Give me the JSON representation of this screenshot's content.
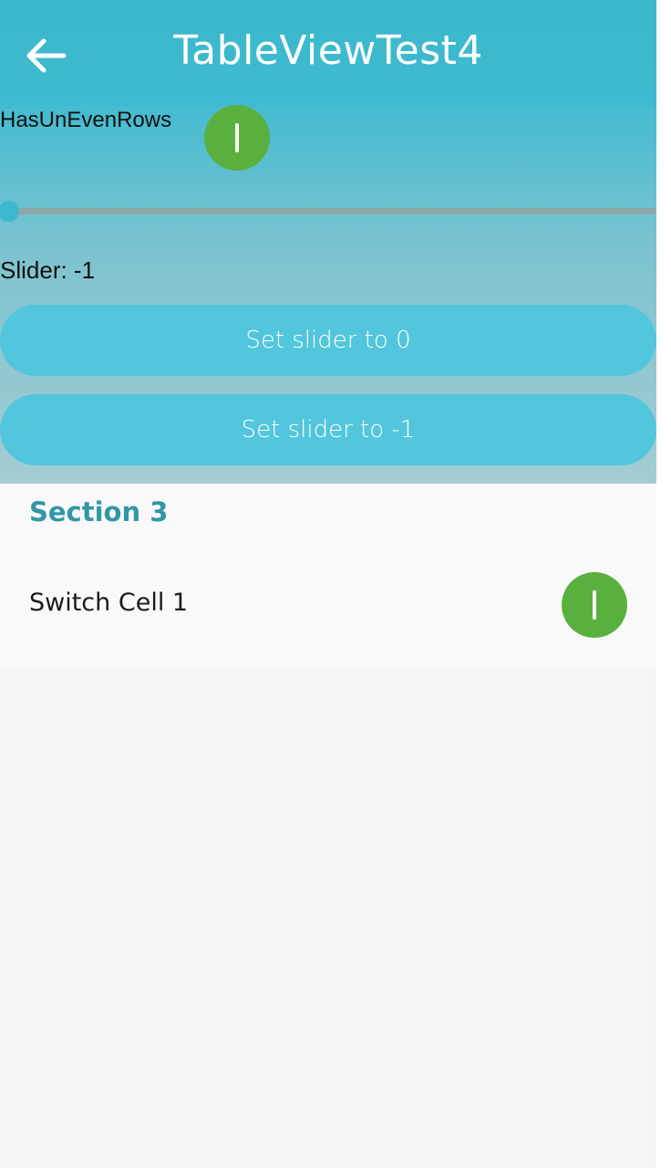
{
  "header": {
    "title": "TableViewTest4",
    "back_icon": "arrow-left-icon"
  },
  "controls": {
    "switch_label": "HasUnEvenRows",
    "switch_on": true,
    "slider_value_text": "Slider: -1",
    "slider_fraction": 0,
    "button_set_zero": "Set slider to 0",
    "button_set_neg_one": "Set slider to -1"
  },
  "table": {
    "section_title": "Section 3",
    "cells": [
      {
        "label": "Switch Cell 1",
        "on": true
      }
    ]
  },
  "colors": {
    "accent": "#3cb9cf",
    "switch_on": "#5ab03e",
    "button": "#52c6dc",
    "section_title": "#3197a6"
  }
}
